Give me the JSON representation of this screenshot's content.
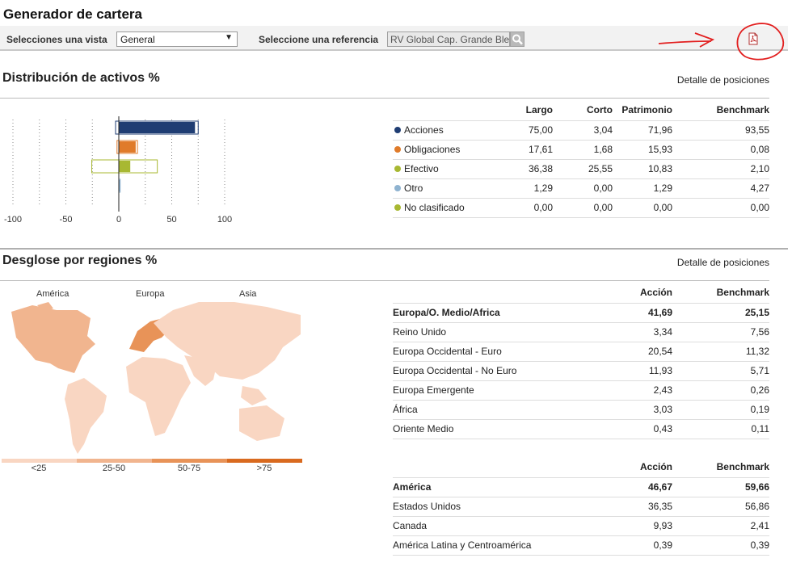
{
  "page_title": "Generador de cartera",
  "toolbar": {
    "view_label": "Selecciones una vista",
    "view_value": "General",
    "reference_label": "Seleccione una referencia",
    "reference_value": "RV Global Cap. Grande Ble"
  },
  "asset_section": {
    "title": "Distribución de activos %",
    "detail_link": "Detalle de posiciones",
    "axis_ticks": [
      "-100",
      "-50",
      "0",
      "50",
      "100"
    ],
    "columns": [
      "Largo",
      "Corto",
      "Patrimonio",
      "Benchmark"
    ],
    "rows": [
      {
        "label": "Acciones",
        "color": "#1f3d73",
        "largo": "75,00",
        "corto": "3,04",
        "patrimonio": "71,96",
        "benchmark": "93,55"
      },
      {
        "label": "Obligaciones",
        "color": "#e07b2a",
        "largo": "17,61",
        "corto": "1,68",
        "patrimonio": "15,93",
        "benchmark": "0,08"
      },
      {
        "label": "Efectivo",
        "color": "#a8b832",
        "largo": "36,38",
        "corto": "25,55",
        "patrimonio": "10,83",
        "benchmark": "2,10"
      },
      {
        "label": "Otro",
        "color": "#8fb3d0",
        "largo": "1,29",
        "corto": "0,00",
        "patrimonio": "1,29",
        "benchmark": "4,27"
      },
      {
        "label": "No clasificado",
        "color": "#a8b832",
        "largo": "0,00",
        "corto": "0,00",
        "patrimonio": "0,00",
        "benchmark": "0,00"
      }
    ]
  },
  "chart_data": {
    "type": "bar",
    "orientation": "horizontal",
    "categories": [
      "Acciones",
      "Obligaciones",
      "Efectivo",
      "Otro",
      "No clasificado"
    ],
    "series": [
      {
        "name": "Largo",
        "values": [
          75.0,
          17.61,
          36.38,
          1.29,
          0.0
        ]
      },
      {
        "name": "Corto",
        "values": [
          3.04,
          1.68,
          25.55,
          0.0,
          0.0
        ]
      },
      {
        "name": "Patrimonio",
        "values": [
          71.96,
          15.93,
          10.83,
          1.29,
          0.0
        ]
      }
    ],
    "xlim": [
      -100,
      100
    ],
    "xticks": [
      -100,
      -50,
      0,
      50,
      100
    ]
  },
  "region_section": {
    "title": "Desglose por regiones %",
    "detail_link": "Detalle de posiciones",
    "map_labels": [
      "América",
      "Europa",
      "Asia"
    ],
    "legend": [
      {
        "label": "<25",
        "color": "#f9d6c2"
      },
      {
        "label": "25-50",
        "color": "#f1b58f"
      },
      {
        "label": "50-75",
        "color": "#e89358"
      },
      {
        "label": ">75",
        "color": "#d96a1f"
      }
    ],
    "col_accion": "Acción",
    "col_benchmark": "Benchmark",
    "table1": [
      {
        "label": "Europa/O. Medio/Africa",
        "accion": "41,69",
        "benchmark": "25,15",
        "bold": true
      },
      {
        "label": "Reino Unido",
        "accion": "3,34",
        "benchmark": "7,56"
      },
      {
        "label": "Europa Occidental - Euro",
        "accion": "20,54",
        "benchmark": "11,32"
      },
      {
        "label": "Europa Occidental - No Euro",
        "accion": "11,93",
        "benchmark": "5,71"
      },
      {
        "label": "Europa Emergente",
        "accion": "2,43",
        "benchmark": "0,26"
      },
      {
        "label": "África",
        "accion": "3,03",
        "benchmark": "0,19"
      },
      {
        "label": "Oriente Medio",
        "accion": "0,43",
        "benchmark": "0,11"
      }
    ],
    "table2": [
      {
        "label": "América",
        "accion": "46,67",
        "benchmark": "59,66",
        "bold": true
      },
      {
        "label": "Estados Unidos",
        "accion": "36,35",
        "benchmark": "56,86"
      },
      {
        "label": "Canada",
        "accion": "9,93",
        "benchmark": "2,41"
      },
      {
        "label": "América Latina y Centroamérica",
        "accion": "0,39",
        "benchmark": "0,39"
      }
    ]
  }
}
